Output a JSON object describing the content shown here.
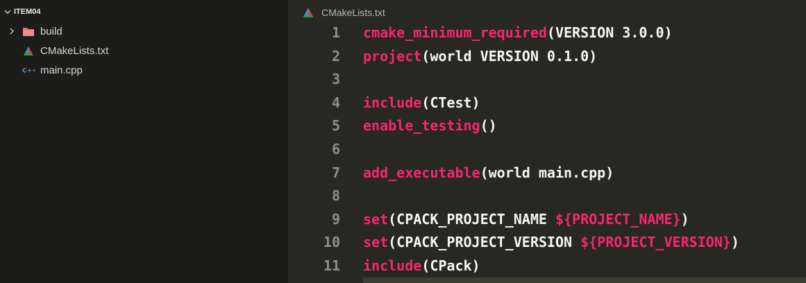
{
  "explorer": {
    "folder_name": "ITEM04",
    "items": [
      {
        "label": "build",
        "type": "folder"
      },
      {
        "label": "CMakeLists.txt",
        "type": "cmake"
      },
      {
        "label": "main.cpp",
        "type": "cpp"
      }
    ]
  },
  "editor": {
    "tab_label": "CMakeLists.txt",
    "line_numbers": [
      "1",
      "2",
      "3",
      "4",
      "5",
      "6",
      "7",
      "8",
      "9",
      "10",
      "11"
    ],
    "lines": [
      {
        "fn": "cmake_minimum_required",
        "rest": "(VERSION 3.0.0)"
      },
      {
        "fn": "project",
        "rest": "(world VERSION 0.1.0)"
      },
      {
        "fn": "",
        "rest": ""
      },
      {
        "fn": "include",
        "rest": "(CTest)"
      },
      {
        "fn": "enable_testing",
        "rest": "()"
      },
      {
        "fn": "",
        "rest": ""
      },
      {
        "fn": "add_executable",
        "rest": "(world main.cpp)"
      },
      {
        "fn": "",
        "rest": ""
      },
      {
        "fn": "set",
        "rest_pre": "(CPACK_PROJECT_NAME ",
        "var": "${PROJECT_NAME}",
        "rest_post": ")"
      },
      {
        "fn": "set",
        "rest_pre": "(CPACK_PROJECT_VERSION ",
        "var": "${PROJECT_VERSION}",
        "rest_post": ")"
      },
      {
        "fn": "include",
        "rest": "(CPack)"
      }
    ]
  },
  "colors": {
    "keyword": "#f92672",
    "text": "#f8f8f2",
    "line_number": "#8f908a",
    "editor_bg": "#272822",
    "sidebar_bg": "#1c1c1a"
  }
}
